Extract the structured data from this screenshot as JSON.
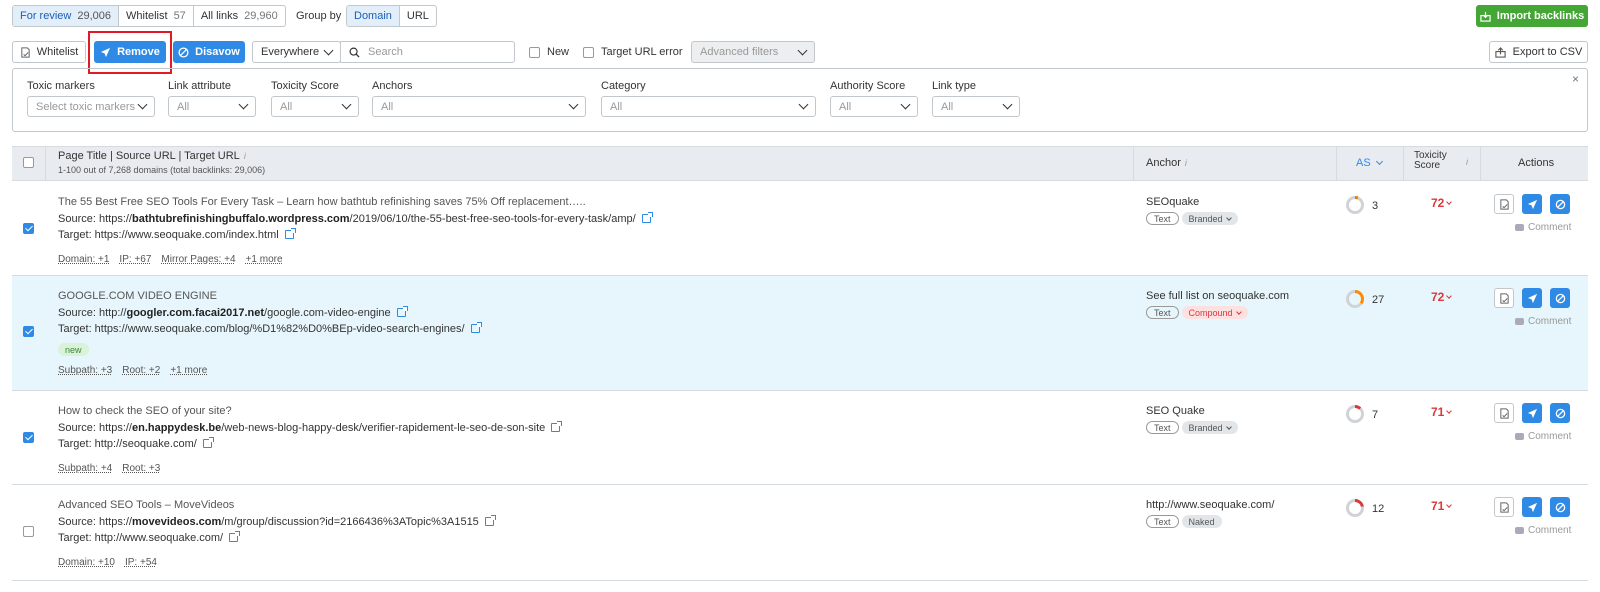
{
  "top_tabs": [
    {
      "label": "For review",
      "count": "29,006"
    },
    {
      "label": "Whitelist",
      "count": "57"
    },
    {
      "label": "All links",
      "count": "29,960"
    }
  ],
  "group_by": {
    "label": "Group by",
    "options": [
      "Domain",
      "URL"
    ]
  },
  "import_label": "Import backlinks",
  "toolbar": {
    "whitelist_label": "Whitelist",
    "remove_label": "Remove",
    "disavow_label": "Disavow",
    "scope_value": "Everywhere",
    "search_placeholder": "Search",
    "new_label": "New",
    "target_url_error_label": "Target URL error",
    "advanced_filters_label": "Advanced filters",
    "export_label": "Export to CSV"
  },
  "filters": [
    {
      "label": "Toxic markers",
      "value": "Select toxic markers"
    },
    {
      "label": "Link attribute",
      "value": "All"
    },
    {
      "label": "Toxicity Score",
      "value": "All"
    },
    {
      "label": "Anchors",
      "value": "All"
    },
    {
      "label": "Category",
      "value": "All"
    },
    {
      "label": "Authority Score",
      "value": "All"
    },
    {
      "label": "Link type",
      "value": "All"
    }
  ],
  "table": {
    "col_page": "Page Title | Source URL | Target URL",
    "summary": "1-100 out of 7,268 domains (total backlinks: 29,006)",
    "col_anchor": "Anchor",
    "col_as": "AS",
    "col_tox_1": "Toxicity",
    "col_tox_2": "Score",
    "col_actions": "Actions",
    "comment_label": "Comment",
    "rows": [
      {
        "title": "The 55 Best Free SEO Tools For Every Task – Learn how bathtub refinishing saves 75% Off replacement…..",
        "source_prefix": "Source: https://",
        "source_bold": "bathtubrefinishingbuffalo.wordpress.com",
        "source_rest": "/2019/06/10/the-55-best-free-seo-tools-for-every-task/amp/",
        "target": "Target: https://www.seoquake.com/index.html",
        "new_badge": "",
        "meta": [
          "Domain: +1",
          "IP: +67",
          "Mirror Pages: +4",
          "+1 more"
        ],
        "anchor": "SEOquake",
        "tag1": "Text",
        "tag2": "Branded",
        "as": "3",
        "tox": "72",
        "checked": true
      },
      {
        "title": "GOOGLE.COM VIDEO ENGINE",
        "source_prefix": "Source: http://",
        "source_bold": "googler.com.facai2017.net",
        "source_rest": "/google.com-video-engine",
        "target": "Target: https://www.seoquake.com/blog/%D1%82%D0%BEp-video-search-engines/",
        "new_badge": "new",
        "meta": [
          "Subpath: +3",
          "Root: +2",
          "+1 more"
        ],
        "anchor": "See full list on seoquake.com",
        "tag1": "Text",
        "tag2": "Compound",
        "as": "27",
        "tox": "72",
        "checked": true
      },
      {
        "title": "How to check the SEO of your site?",
        "source_prefix": "Source: https://",
        "source_bold": "en.happydesk.be",
        "source_rest": "/web-news-blog-happy-desk/verifier-rapidement-le-seo-de-son-site",
        "target": "Target: http://seoquake.com/",
        "new_badge": "",
        "meta": [
          "Subpath: +4",
          "Root: +3"
        ],
        "anchor": "SEO Quake",
        "tag1": "Text",
        "tag2": "Branded",
        "as": "7",
        "tox": "71",
        "checked": true
      },
      {
        "title": "Advanced SEO Tools – MoveVideos",
        "source_prefix": "Source: https://",
        "source_bold": "movevideos.com",
        "source_rest": "/m/group/discussion?id=2166436%3ATopic%3A1515",
        "target": "Target: http://www.seoquake.com/",
        "new_badge": "",
        "meta": [
          "Domain: +10",
          "IP: +54"
        ],
        "anchor": "http://www.seoquake.com/",
        "tag1": "Text",
        "tag2": "Naked",
        "as": "12",
        "tox": "71",
        "checked": false
      }
    ]
  },
  "colors": {
    "accent": "#2f8ae5",
    "green": "#44a634",
    "toxic": "#d9393b",
    "highlight": "#e01b24",
    "selected_row": "#e7f6fc"
  }
}
